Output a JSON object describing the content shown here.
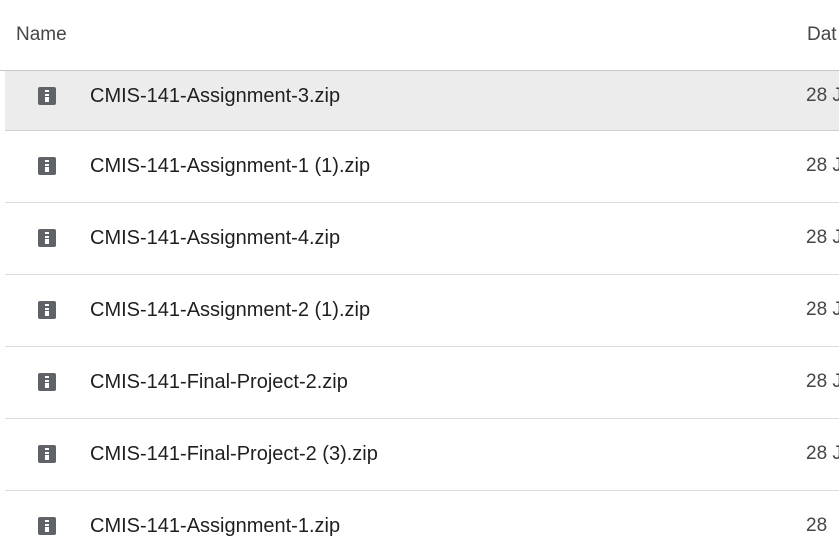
{
  "header": {
    "name_label": "Name",
    "date_label": "Dat"
  },
  "files": [
    {
      "name": "CMIS-141-Assignment-3.zip",
      "date": "28 J",
      "icon": "zip-file-icon"
    },
    {
      "name": "CMIS-141-Assignment-1 (1).zip",
      "date": "28 J",
      "icon": "zip-file-icon"
    },
    {
      "name": "CMIS-141-Assignment-4.zip",
      "date": "28 J",
      "icon": "zip-file-icon"
    },
    {
      "name": "CMIS-141-Assignment-2 (1).zip",
      "date": "28 J",
      "icon": "zip-file-icon"
    },
    {
      "name": "CMIS-141-Final-Project-2.zip",
      "date": "28 J",
      "icon": "zip-file-icon"
    },
    {
      "name": "CMIS-141-Final-Project-2 (3).zip",
      "date": "28 J",
      "icon": "zip-file-icon"
    },
    {
      "name": "CMIS-141-Assignment-1.zip",
      "date": "28",
      "icon": "zip-file-icon"
    }
  ],
  "colors": {
    "selected_row_bg": "#ececec",
    "icon": "#5f6368",
    "divider": "#dadce0"
  }
}
